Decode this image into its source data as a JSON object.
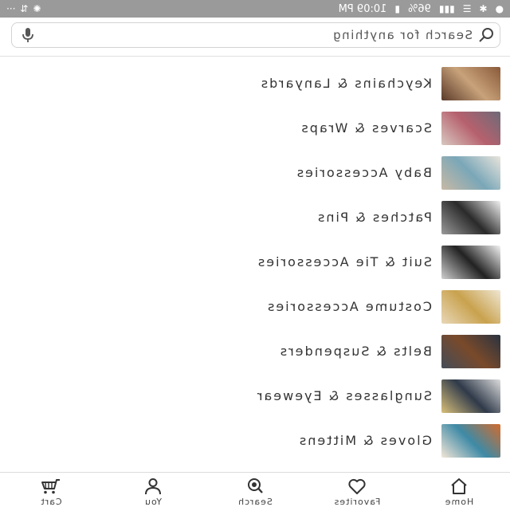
{
  "status_bar": {
    "time": "10:09 PM",
    "battery": "96%",
    "left_icons": [
      "location-icon",
      "bluetooth-icon",
      "wifi-icon",
      "signal-icon"
    ],
    "right_icons": [
      "fan-icon",
      "sync-icon",
      "more-icon"
    ]
  },
  "search": {
    "placeholder": "Search for anything"
  },
  "categories": [
    {
      "label": "Keychains & Lanyards",
      "thumb_colors": [
        "#8a5a3a",
        "#c8a27a",
        "#5a3a2a"
      ]
    },
    {
      "label": "Scarves & Wraps",
      "thumb_colors": [
        "#6e6a78",
        "#b6616d",
        "#d8c8c0"
      ]
    },
    {
      "label": "Baby Accessories",
      "thumb_colors": [
        "#e9e4dc",
        "#7aa7b8",
        "#c8b9a5"
      ]
    },
    {
      "label": "Patches & Pins",
      "thumb_colors": [
        "#f1f1f1",
        "#2a2a2a",
        "#9a9a9a"
      ]
    },
    {
      "label": "Suit & Tie Accessories",
      "thumb_colors": [
        "#f4f4f4",
        "#222222",
        "#cfcfcf"
      ]
    },
    {
      "label": "Costume Accessories",
      "thumb_colors": [
        "#efe6d2",
        "#c9a24e",
        "#e8d7b8"
      ]
    },
    {
      "label": "Belts & Suspenders",
      "thumb_colors": [
        "#2a3340",
        "#7a4a2a",
        "#444c58"
      ]
    },
    {
      "label": "Sunglasses & Eyewear",
      "thumb_colors": [
        "#dcdcdc",
        "#2f3a4a",
        "#d9c07a"
      ]
    },
    {
      "label": "Gloves & Mittens",
      "thumb_colors": [
        "#d36b2c",
        "#3e8aa6",
        "#f3e6d6"
      ]
    }
  ],
  "bottom_nav": [
    {
      "label": "Home",
      "icon": "home-icon"
    },
    {
      "label": "Favorites",
      "icon": "heart-icon"
    },
    {
      "label": "Search",
      "icon": "search-icon"
    },
    {
      "label": "You",
      "icon": "user-icon"
    },
    {
      "label": "Cart",
      "icon": "cart-icon"
    }
  ],
  "colors": {
    "status_bar_bg": "#9a9a9a",
    "text": "#333333",
    "divider": "#e0e0e0"
  }
}
